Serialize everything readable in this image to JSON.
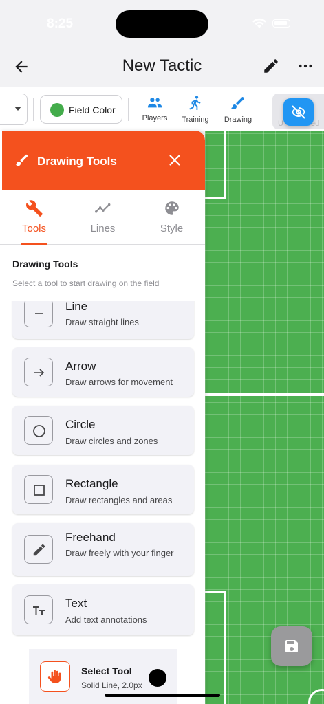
{
  "status_bar": {
    "time": "8:25"
  },
  "app_bar": {
    "title": "New Tactic",
    "back_icon": "arrow-left-icon",
    "edit_icon": "pencil-icon",
    "more_icon": "more-horizontal-icon"
  },
  "toolbar": {
    "field_color_label": "Field Color",
    "field_color": "#43ac4b",
    "items": [
      {
        "label": "Players",
        "icon": "people-icon"
      },
      {
        "label": "Training",
        "icon": "runner-icon"
      },
      {
        "label": "Drawing",
        "icon": "brush-icon"
      }
    ],
    "undo_label_partial": "U",
    "redo_label_partial": "ed"
  },
  "panel": {
    "title": "Drawing Tools",
    "accent_color": "#f4511e",
    "tabs": [
      {
        "label": "Tools",
        "icon": "wrench-icon",
        "active": true
      },
      {
        "label": "Lines",
        "icon": "chart-line-icon",
        "active": false
      },
      {
        "label": "Style",
        "icon": "palette-icon",
        "active": false
      }
    ],
    "section_title": "Drawing Tools",
    "section_subtitle": "Select a tool to start drawing on the field",
    "tools": [
      {
        "name": "Line",
        "desc": "Draw straight lines",
        "icon": "minus-icon"
      },
      {
        "name": "Arrow",
        "desc": "Draw arrows for movement",
        "icon": "arrow-right-icon"
      },
      {
        "name": "Circle",
        "desc": "Draw circles and zones",
        "icon": "circle-icon"
      },
      {
        "name": "Rectangle",
        "desc": "Draw rectangles and areas",
        "icon": "square-icon"
      },
      {
        "name": "Freehand",
        "desc": "Draw freely with your finger",
        "icon": "pencil-icon"
      },
      {
        "name": "Text",
        "desc": "Add text annotations",
        "icon": "text-size-icon"
      }
    ],
    "selected": {
      "name": "Select Tool",
      "desc": "Solid Line, 2.0px",
      "color": "#000000",
      "icon": "hand-icon"
    }
  }
}
